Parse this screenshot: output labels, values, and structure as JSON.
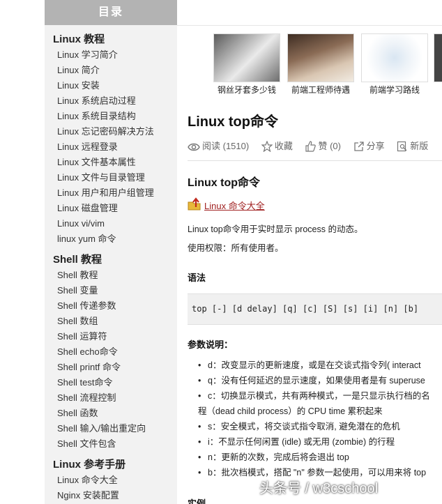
{
  "sidebar": {
    "header": "目录",
    "groups": [
      {
        "title": "Linux 教程",
        "items": [
          "Linux 学习简介",
          "Linux 简介",
          "Linux 安装",
          "Linux 系统启动过程",
          "Linux 系统目录结构",
          "Linux 忘记密码解决方法",
          "Linux 远程登录",
          "Linux 文件基本属性",
          "Linux 文件与目录管理",
          "Linux 用户和用户组管理",
          "Linux 磁盘管理",
          "Linux vi/vim",
          "linux yum 命令"
        ]
      },
      {
        "title": "Shell 教程",
        "items": [
          "Shell 教程",
          "Shell 变量",
          "Shell 传递参数",
          "Shell 数组",
          "Shell 运算符",
          "Shell echo命令",
          "Shell printf 命令",
          "Shell test命令",
          "Shell 流程控制",
          "Shell 函数",
          "Shell 输入/输出重定向",
          "Shell 文件包含"
        ]
      },
      {
        "title": "Linux 参考手册",
        "items": [
          "Linux 命令大全",
          "Nginx 安装配置"
        ]
      }
    ]
  },
  "thumbs": [
    {
      "caption": "钢丝牙套多少钱"
    },
    {
      "caption": "前端工程师待遇"
    },
    {
      "caption": "前端学习路线"
    }
  ],
  "article": {
    "title": "Linux top命令",
    "actions": {
      "read": "阅读 (1510)",
      "favorite": "收藏",
      "like": "赞 (0)",
      "share": "分享",
      "new_tab": "新版"
    },
    "section_title": "Linux top命令",
    "cmd_link": "Linux 命令大全",
    "desc1": "Linux top命令用于实时显示 process 的动态。",
    "desc2": "使用权限：所有使用者。",
    "syntax_heading": "语法",
    "syntax_code": "top [-] [d delay] [q] [c] [S] [s] [i] [n] [b]",
    "params_heading": "参数说明：",
    "params": [
      "d：改变显示的更新速度，或是在交谈式指令列( interact",
      "q：没有任何延迟的显示速度，如果使用者是有 superuse",
      "c：切换显示模式，共有两种模式，一是只显示执行档的名",
      "程（dead child process）的 CPU time 累积起来",
      "s：安全模式，将交谈式指令取消, 避免潜在的危机",
      "i：不显示任何闲置 (idle) 或无用 (zombie) 的行程",
      "n：更新的次数，完成后将会退出 top",
      "b：批次档模式，搭配 \"n\" 参数一起使用，可以用来将 top"
    ],
    "example_heading": "实例"
  },
  "watermark": "头条号 / w3cschool",
  "colors": {
    "sidebar_bg": "#f2f2f2",
    "sidebar_header_bg": "#b3b3b3",
    "link_color": "#a02020",
    "code_bg": "#f0f0f0"
  }
}
